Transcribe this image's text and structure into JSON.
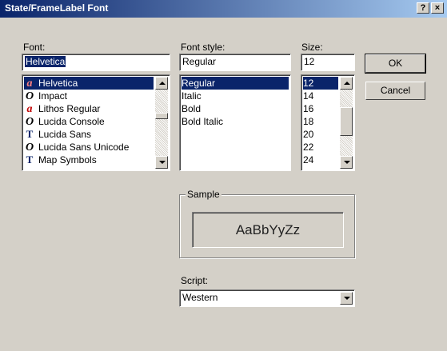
{
  "window": {
    "title": "State/FrameLabel Font",
    "help_label": "?",
    "close_label": "×"
  },
  "font": {
    "label": "Font:",
    "value": "Helvetica",
    "items": [
      {
        "icon": "a",
        "label": "Helvetica",
        "selected": true
      },
      {
        "icon": "O",
        "label": "Impact"
      },
      {
        "icon": "a",
        "label": "Lithos Regular"
      },
      {
        "icon": "O",
        "label": "Lucida Console"
      },
      {
        "icon": "T",
        "label": "Lucida Sans"
      },
      {
        "icon": "O",
        "label": "Lucida Sans Unicode"
      },
      {
        "icon": "T",
        "label": "Map Symbols"
      }
    ]
  },
  "style": {
    "label": "Font style:",
    "value": "Regular",
    "items": [
      {
        "label": "Regular",
        "selected": true
      },
      {
        "label": "Italic"
      },
      {
        "label": "Bold"
      },
      {
        "label": "Bold Italic"
      }
    ]
  },
  "size": {
    "label": "Size:",
    "value": "12",
    "items": [
      {
        "label": "12",
        "selected": true
      },
      {
        "label": "14"
      },
      {
        "label": "16"
      },
      {
        "label": "18"
      },
      {
        "label": "20"
      },
      {
        "label": "22"
      },
      {
        "label": "24"
      }
    ]
  },
  "buttons": {
    "ok_label": "OK",
    "cancel_label": "Cancel"
  },
  "sample": {
    "legend": "Sample",
    "text": "AaBbYyZz"
  },
  "script": {
    "label": "Script:",
    "value": "Western"
  }
}
